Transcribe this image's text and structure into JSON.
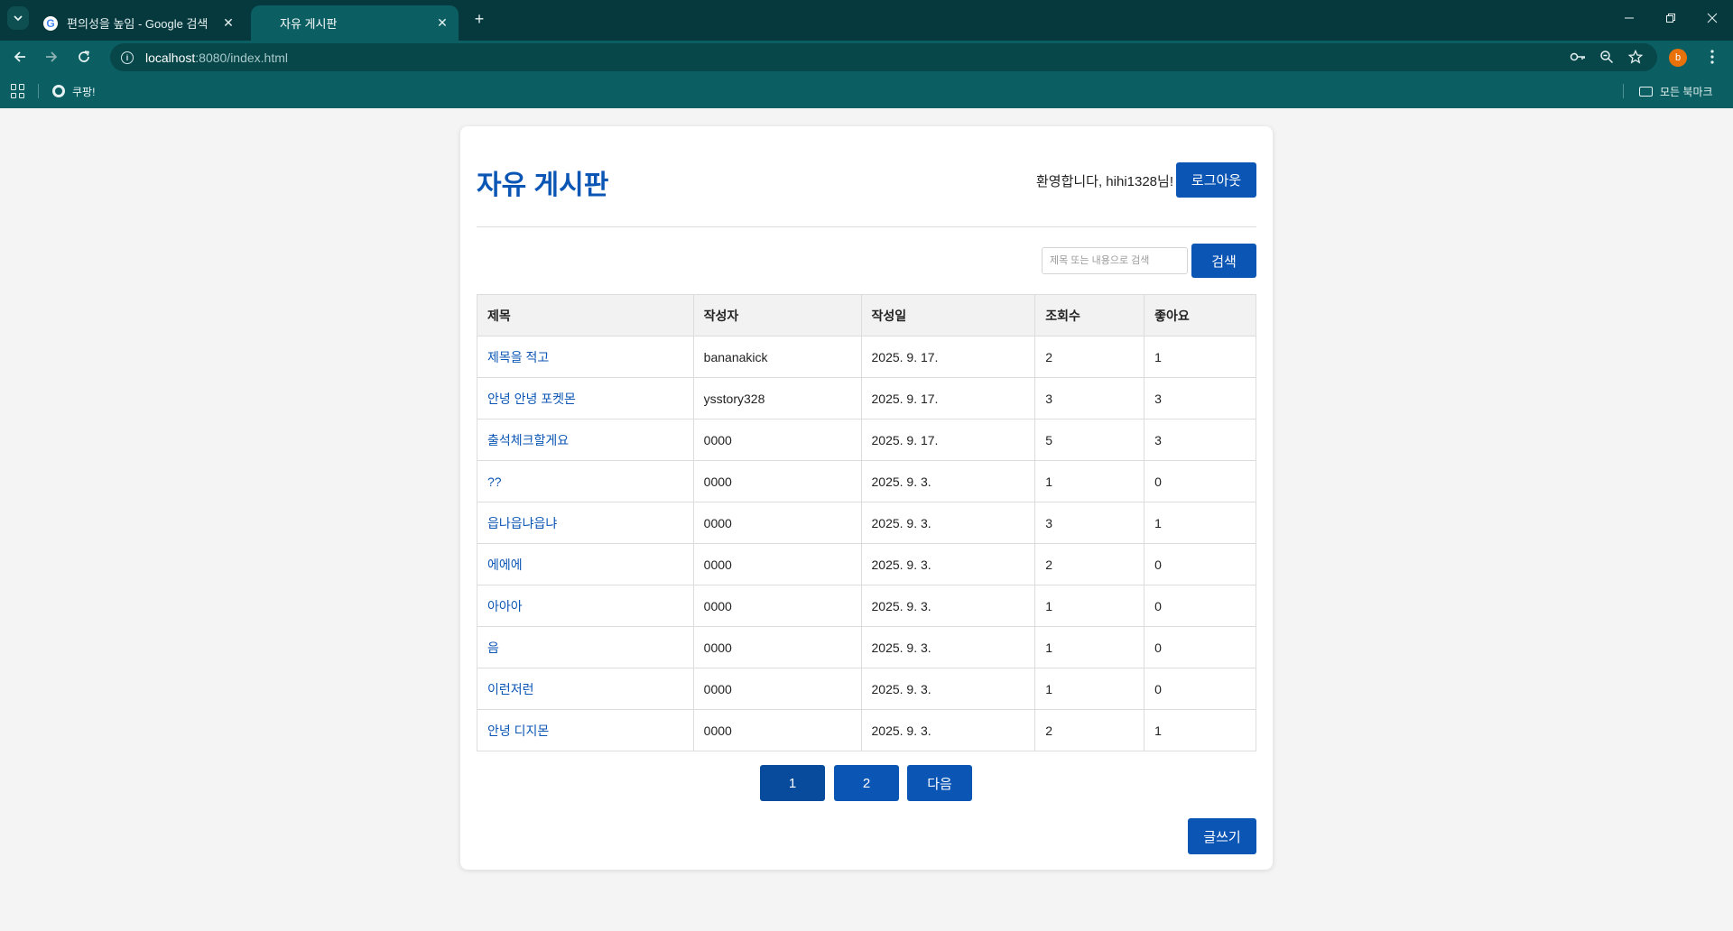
{
  "browser": {
    "tabs": [
      {
        "label": "편의성을 높임 - Google 검색",
        "favicon": "google-icon",
        "active": false
      },
      {
        "label": "자유 게시판",
        "favicon": "",
        "active": true
      }
    ],
    "url_host": "localhost",
    "url_rest": ":8080/index.html",
    "profile_initial": "b",
    "bookmarks": [
      {
        "label": "쿠팡!",
        "icon": "globe-icon"
      }
    ],
    "all_bookmarks_label": "모든 북마크"
  },
  "page": {
    "title": "자유 게시판",
    "welcome": "환영합니다, hihi1328님!",
    "logout_label": "로그아웃",
    "search_placeholder": "제목 또는 내용으로 검색",
    "search_label": "검색",
    "table": {
      "headers": [
        "제목",
        "작성자",
        "작성일",
        "조회수",
        "좋아요"
      ],
      "rows": [
        {
          "title": "제목을 적고",
          "author": "bananakick",
          "date": "2025. 9. 17.",
          "views": "2",
          "likes": "1"
        },
        {
          "title": "안녕 안녕 포켓몬",
          "author": "ysstory328",
          "date": "2025. 9. 17.",
          "views": "3",
          "likes": "3"
        },
        {
          "title": "출석체크할게요",
          "author": "0000",
          "date": "2025. 9. 17.",
          "views": "5",
          "likes": "3"
        },
        {
          "title": "??",
          "author": "0000",
          "date": "2025. 9. 3.",
          "views": "1",
          "likes": "0"
        },
        {
          "title": "읍나읍냐읍냐",
          "author": "0000",
          "date": "2025. 9. 3.",
          "views": "3",
          "likes": "1"
        },
        {
          "title": "에에에",
          "author": "0000",
          "date": "2025. 9. 3.",
          "views": "2",
          "likes": "0"
        },
        {
          "title": "아아아",
          "author": "0000",
          "date": "2025. 9. 3.",
          "views": "1",
          "likes": "0"
        },
        {
          "title": "음",
          "author": "0000",
          "date": "2025. 9. 3.",
          "views": "1",
          "likes": "0"
        },
        {
          "title": "이런저런",
          "author": "0000",
          "date": "2025. 9. 3.",
          "views": "1",
          "likes": "0"
        },
        {
          "title": "안녕 디지몬",
          "author": "0000",
          "date": "2025. 9. 3.",
          "views": "2",
          "likes": "1"
        }
      ]
    },
    "pagination": {
      "pages": [
        "1",
        "2"
      ],
      "current": "1",
      "next_label": "다음"
    },
    "write_label": "글쓰기"
  },
  "colors": {
    "accent": "#0b56b5",
    "accent_active": "#084a9c",
    "chrome": "#0b5f63",
    "chrome_dark": "#05393d"
  }
}
